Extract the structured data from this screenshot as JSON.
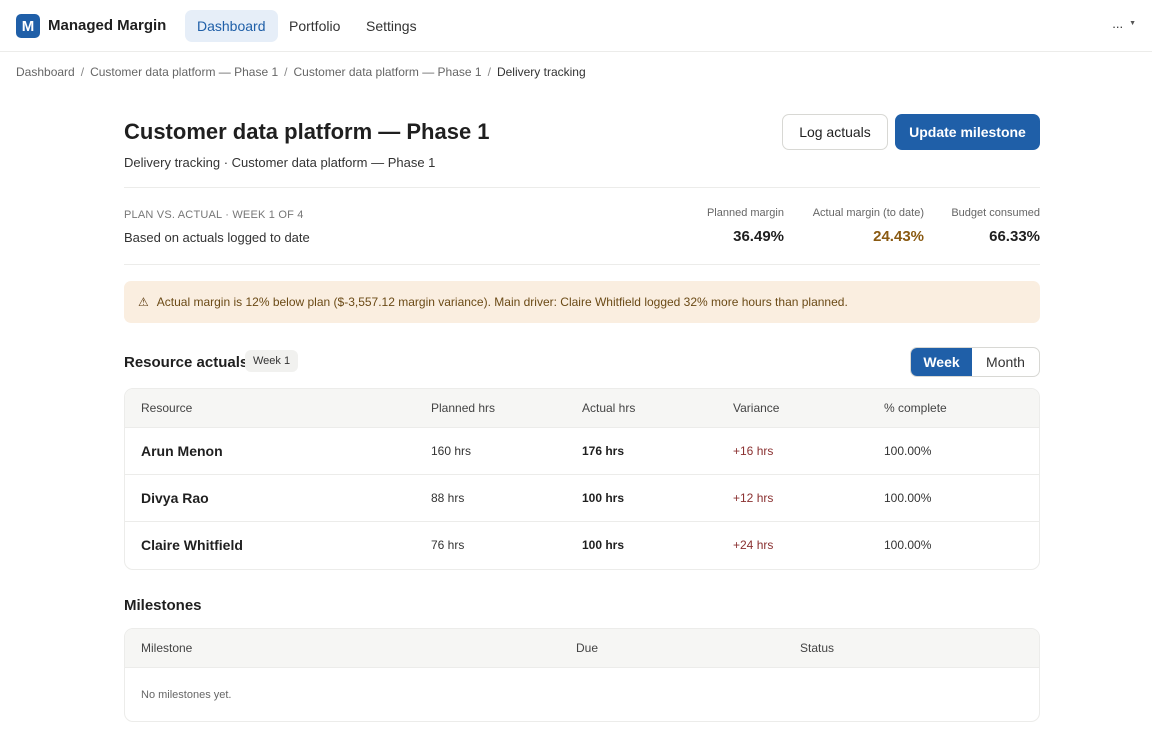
{
  "app": {
    "logo_letter": "M",
    "name": "Managed Margin",
    "nav": [
      "Dashboard",
      "Portfolio",
      "Settings"
    ],
    "active_nav": "Dashboard",
    "more_label": "..."
  },
  "breadcrumb": [
    "Dashboard",
    "Customer data platform — Phase 1",
    "Customer data platform — Phase 1",
    "Delivery tracking"
  ],
  "header": {
    "title": "Customer data platform — Phase 1",
    "subtitle": "Delivery tracking · Customer data platform — Phase 1",
    "log_actuals": "Log actuals",
    "update_milestone": "Update milestone"
  },
  "summary": {
    "label": "PLAN VS. ACTUAL · WEEK 1 OF 4",
    "note": "Based on actuals logged to date",
    "metrics": [
      {
        "label": "Planned margin",
        "value": "36.49%"
      },
      {
        "label": "Actual margin (to date)",
        "value": "24.43%"
      },
      {
        "label": "Budget consumed",
        "value": "66.33%"
      }
    ]
  },
  "alert": {
    "icon": "warning-icon",
    "text": "Actual margin is 12% below plan ($-3,557.12 margin variance). Main driver: Claire Whitfield logged 32% more hours than planned."
  },
  "resources": {
    "title": "Resource actuals",
    "period_badge": "Week 1",
    "toggle": [
      "Week",
      "Month"
    ],
    "toggle_selected": "Week",
    "columns": [
      "Resource",
      "Planned hrs",
      "Actual hrs",
      "Variance",
      "% complete"
    ],
    "rows": [
      {
        "name": "Arun Menon",
        "planned": "160 hrs",
        "actual": "176 hrs",
        "variance": "+16 hrs",
        "complete": "100.00%"
      },
      {
        "name": "Divya Rao",
        "planned": "88 hrs",
        "actual": "100 hrs",
        "variance": "+12 hrs",
        "complete": "100.00%"
      },
      {
        "name": "Claire Whitfield",
        "planned": "76 hrs",
        "actual": "100 hrs",
        "variance": "+24 hrs",
        "complete": "100.00%"
      }
    ]
  },
  "milestones": {
    "title": "Milestones",
    "columns": [
      "Milestone",
      "Due",
      "Status"
    ],
    "empty": "No milestones yet."
  },
  "colors": {
    "primary": "#1f5fa8",
    "warning_text": "#8a5a12",
    "alert_bg": "#faeee0",
    "variance": "#8a3030"
  }
}
